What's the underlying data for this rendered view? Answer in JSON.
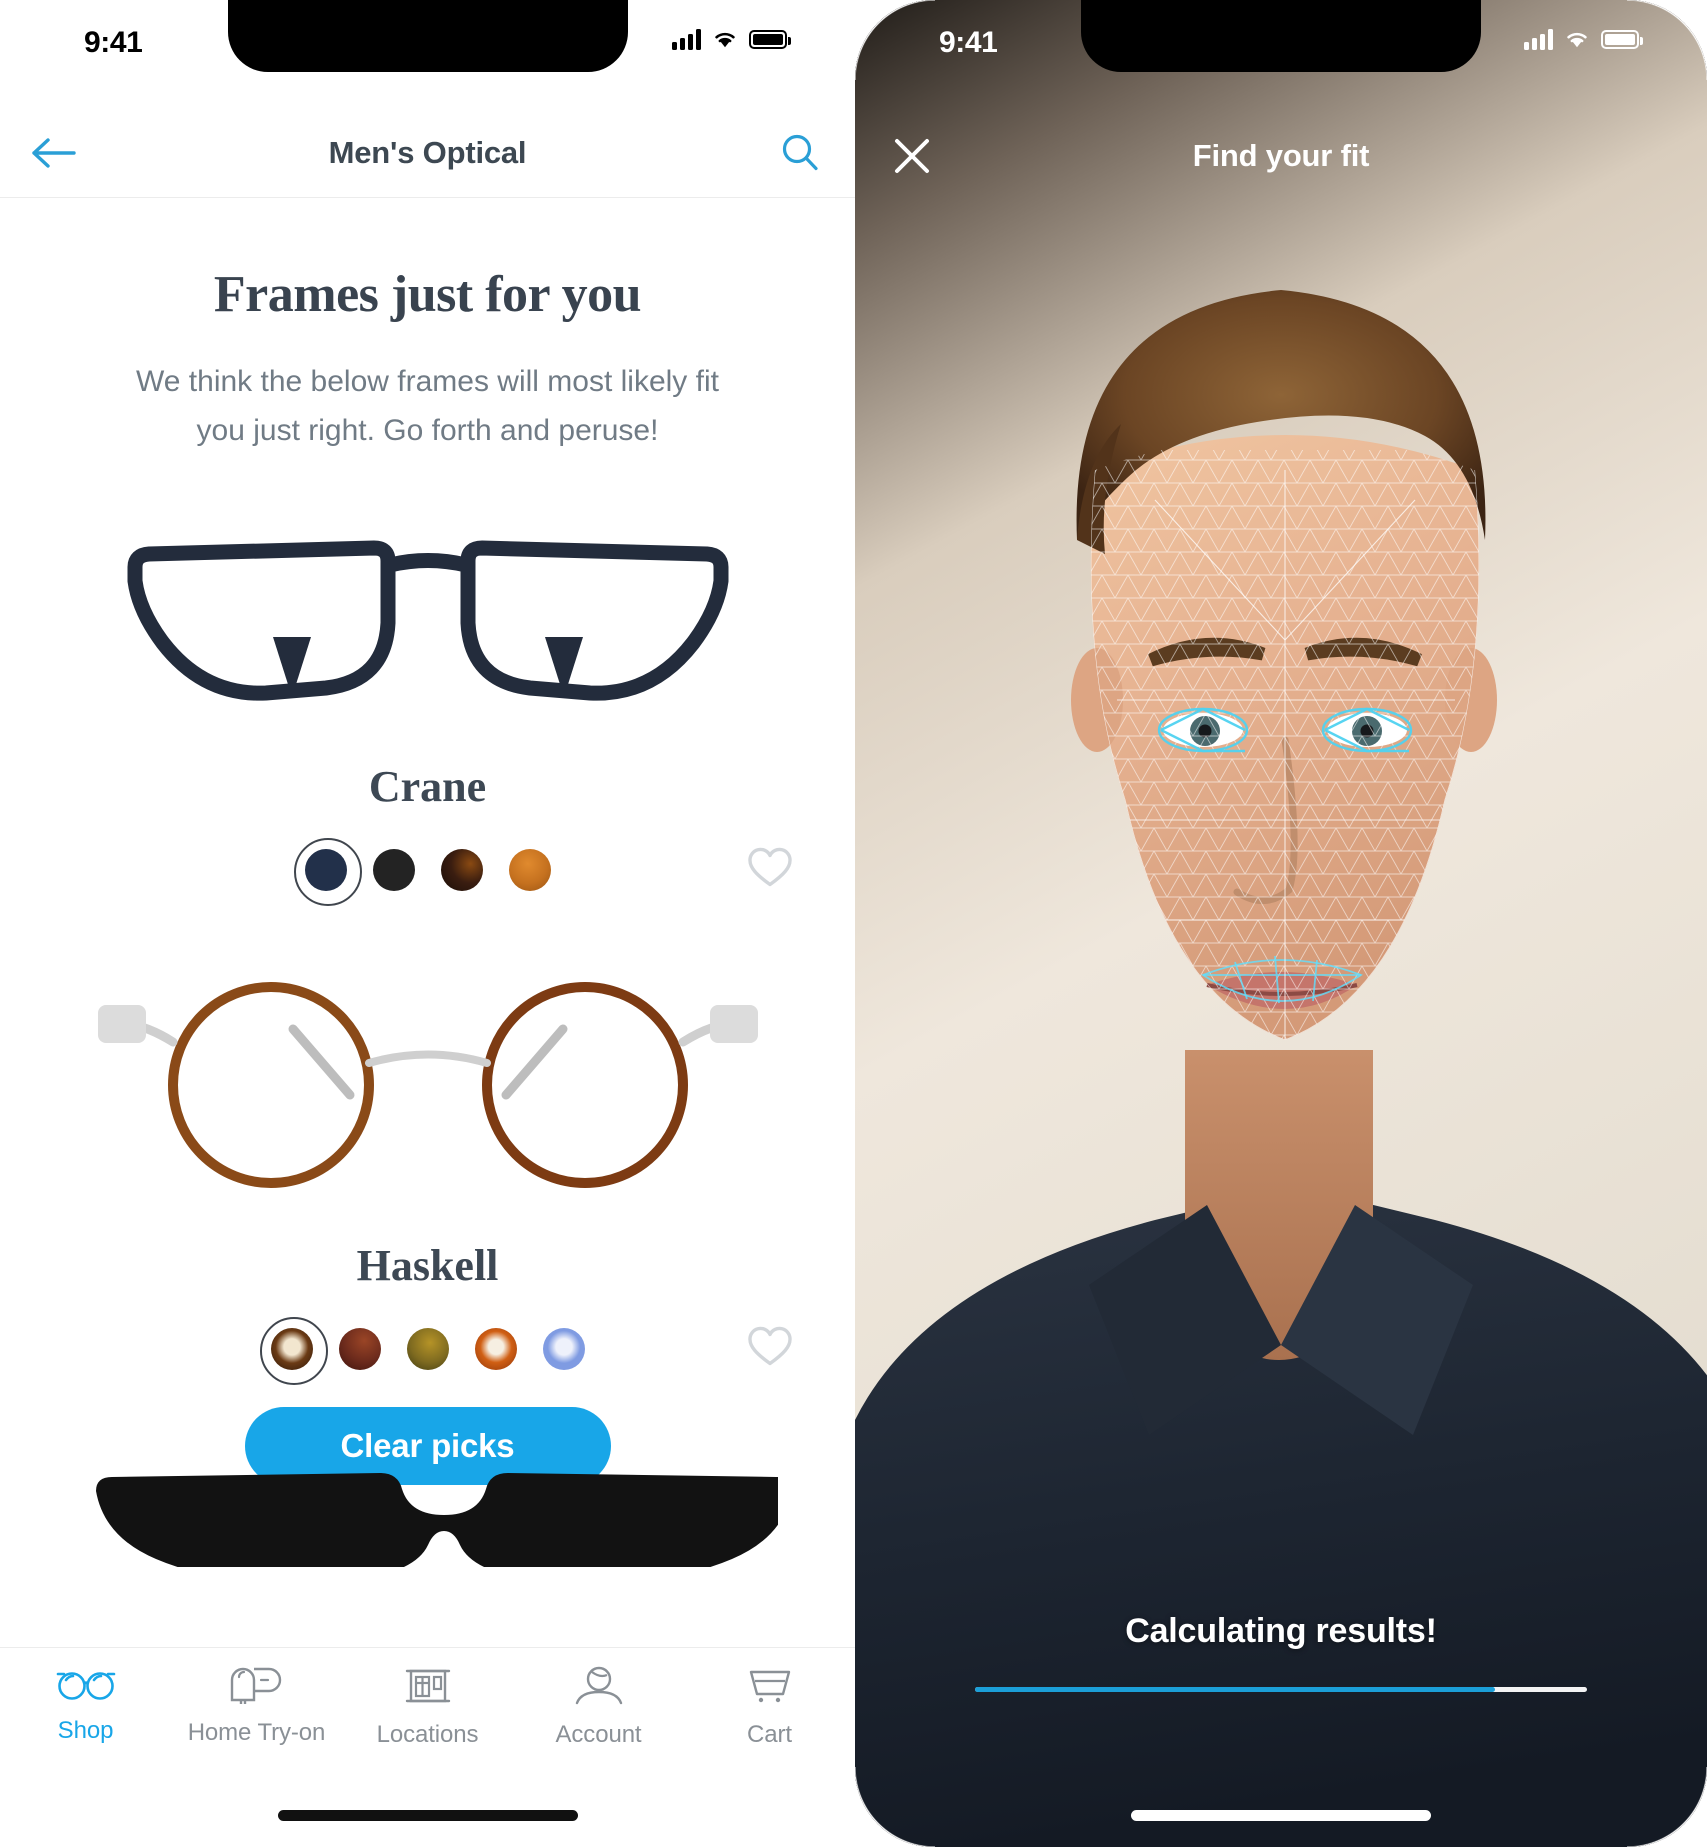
{
  "shop_phone": {
    "status_bar": {
      "time": "9:41",
      "signal_icon": "cellular-bars-icon",
      "wifi_icon": "wifi-icon",
      "battery_icon": "battery-full-icon"
    },
    "nav": {
      "title": "Men's Optical",
      "back_icon": "back-arrow-icon",
      "search_icon": "search-icon",
      "accent_color": "#2a9fd6"
    },
    "hero": {
      "title": "Frames just for you",
      "subtitle": "We think the below frames will most likely fit you just right. Go forth and peruse!"
    },
    "products": [
      {
        "name": "Crane",
        "frame_icon": "rectangular-eyeglasses-navy",
        "favorite_icon": "heart-outline-icon",
        "swatches": [
          {
            "name": "navy",
            "color": "#22304a",
            "selected": true
          },
          {
            "name": "black",
            "color": "#232323",
            "selected": false
          },
          {
            "name": "dark-tortoise",
            "color": "#2c1a12",
            "selected": false
          },
          {
            "name": "amber",
            "color": "#c8772a",
            "selected": false
          }
        ]
      },
      {
        "name": "Haskell",
        "frame_icon": "round-eyeglasses-tortoise",
        "favorite_icon": "heart-outline-icon",
        "swatches": [
          {
            "name": "tortoise",
            "color": "#3a2112",
            "selected": true
          },
          {
            "name": "oxblood",
            "color": "#6b2a1c",
            "selected": false
          },
          {
            "name": "olive-amber",
            "color": "#7e6a20",
            "selected": false
          },
          {
            "name": "burnt-orange",
            "color": "#c25417",
            "selected": false
          },
          {
            "name": "periwinkle",
            "color": "#7f9be2",
            "selected": false
          }
        ]
      }
    ],
    "clear_picks_label": "Clear picks",
    "clear_picks_color": "#18a6e8",
    "third_frame_icon": "black-eyeglasses-partial",
    "tabs": [
      {
        "label": "Shop",
        "icon": "eyeglasses-icon",
        "active": true
      },
      {
        "label": "Home Try-on",
        "icon": "mailbox-icon",
        "active": false
      },
      {
        "label": "Locations",
        "icon": "storefront-icon",
        "active": false
      },
      {
        "label": "Account",
        "icon": "person-icon",
        "active": false
      },
      {
        "label": "Cart",
        "icon": "shopping-cart-icon",
        "active": false
      }
    ]
  },
  "ar_phone": {
    "status_bar": {
      "time": "9:41",
      "signal_icon": "cellular-bars-icon",
      "wifi_icon": "wifi-icon",
      "battery_icon": "battery-full-icon"
    },
    "title": "Find your fit",
    "close_icon": "close-x-icon",
    "status_text": "Calculating results!",
    "progress_percent": 85,
    "progress_color": "#1b9fd8",
    "overlay_icon": "face-mesh-overlay"
  }
}
